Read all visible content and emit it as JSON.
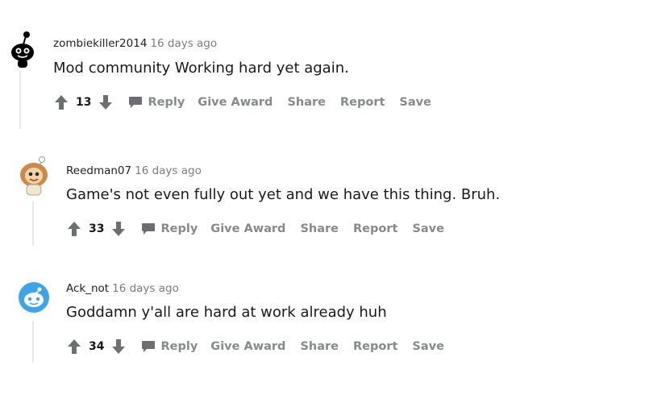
{
  "comments": [
    {
      "username": "zombiekiller2014",
      "timestamp": "16 days ago",
      "body": "Mod community Working hard yet again.",
      "score": "13",
      "avatar_icon": "snoo-black-avatar-icon"
    },
    {
      "username": "Reedman07",
      "timestamp": "16 days ago",
      "body": "Game's not even fully out yet and we have this thing. Bruh.",
      "score": "33",
      "avatar_icon": "snoo-lion-avatar-icon"
    },
    {
      "username": "Ack_not",
      "timestamp": "16 days ago",
      "body": "Goddamn y'all are hard at work already huh",
      "score": "34",
      "avatar_icon": "snoo-blue-avatar-icon"
    }
  ],
  "actions": {
    "reply": "Reply",
    "give_award": "Give Award",
    "share": "Share",
    "report": "Report",
    "save": "Save"
  },
  "icons": {
    "upvote": "upvote-arrow-icon",
    "downvote": "downvote-arrow-icon",
    "reply": "speech-bubble-icon"
  },
  "colors": {
    "action_gray": "#878a8c",
    "thread_line": "#e8e8e8",
    "snoo_blue": "#3fa3e8"
  }
}
